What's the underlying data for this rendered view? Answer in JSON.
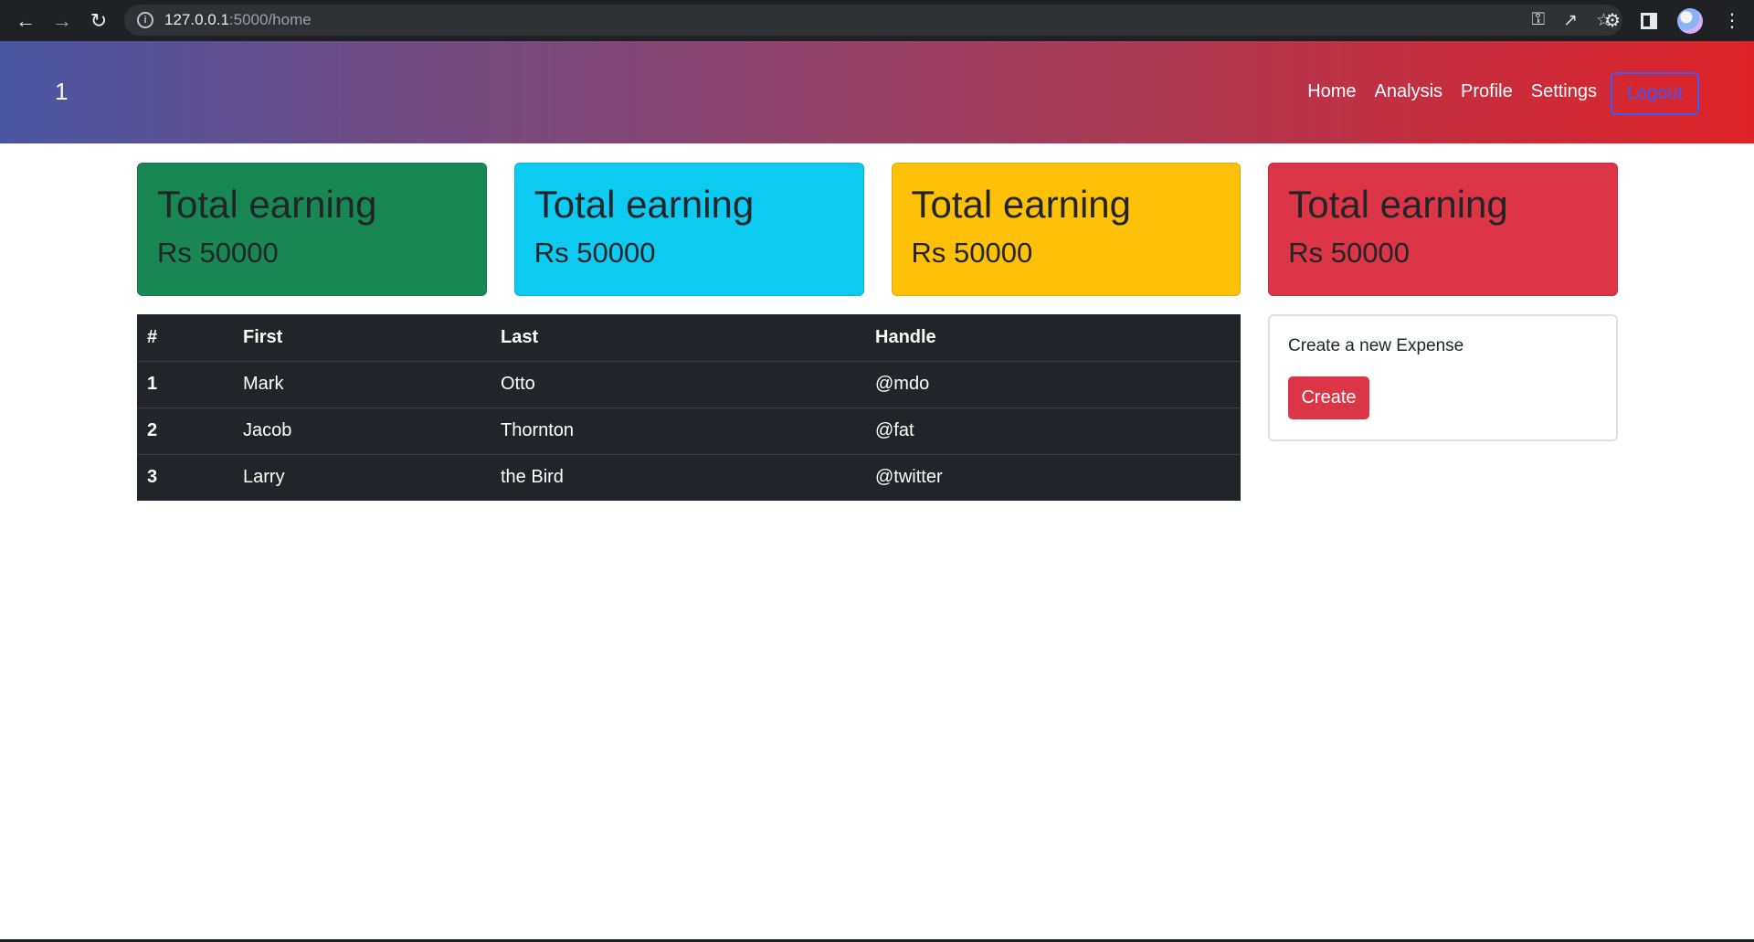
{
  "browser": {
    "url_host": "127.0.0.1",
    "url_path": ":5000/home"
  },
  "navbar": {
    "brand": "1",
    "links": [
      "Home",
      "Analysis",
      "Profile",
      "Settings"
    ],
    "logout_label": "Logout"
  },
  "cards": [
    {
      "title": "Total earning",
      "value": "Rs 50000",
      "color": "#198754"
    },
    {
      "title": "Total earning",
      "value": "Rs 50000",
      "color": "#0dcaf0"
    },
    {
      "title": "Total earning",
      "value": "Rs 50000",
      "color": "#ffc107"
    },
    {
      "title": "Total earning",
      "value": "Rs 50000",
      "color": "#dc3545"
    }
  ],
  "table": {
    "headers": [
      "#",
      "First",
      "Last",
      "Handle"
    ],
    "rows": [
      [
        "1",
        "Mark",
        "Otto",
        "@mdo"
      ],
      [
        "2",
        "Jacob",
        "Thornton",
        "@fat"
      ],
      [
        "3",
        "Larry",
        "the Bird",
        "@twitter"
      ]
    ]
  },
  "expense": {
    "prompt": "Create a new Expense",
    "button_label": "Create"
  }
}
